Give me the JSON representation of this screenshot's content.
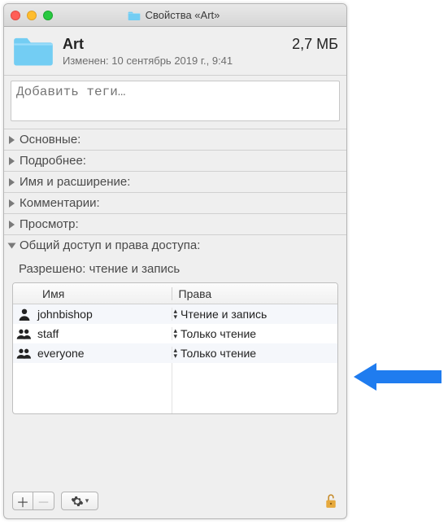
{
  "window": {
    "title": "Свойства «Art»"
  },
  "header": {
    "name": "Art",
    "size": "2,7 МБ",
    "modified": "Изменен: 10 сентябрь 2019 г., 9:41"
  },
  "tags": {
    "placeholder": "Добавить теги…"
  },
  "sections": {
    "general": "Основные:",
    "more": "Подробнее:",
    "name_ext": "Имя и расширение:",
    "comments": "Комментарии:",
    "preview": "Просмотр:",
    "sharing": "Общий доступ и права доступа:"
  },
  "sharing": {
    "allowed": "Разрешено: чтение и запись",
    "columns": {
      "name": "Имя",
      "priv": "Права"
    },
    "rows": [
      {
        "icon": "user",
        "name": "johnbishop",
        "priv": "Чтение и запись"
      },
      {
        "icon": "group",
        "name": "staff",
        "priv": "Только чтение"
      },
      {
        "icon": "group",
        "name": "everyone",
        "priv": "Только чтение"
      }
    ]
  },
  "buttons": {
    "add": "＋",
    "remove": "－"
  }
}
